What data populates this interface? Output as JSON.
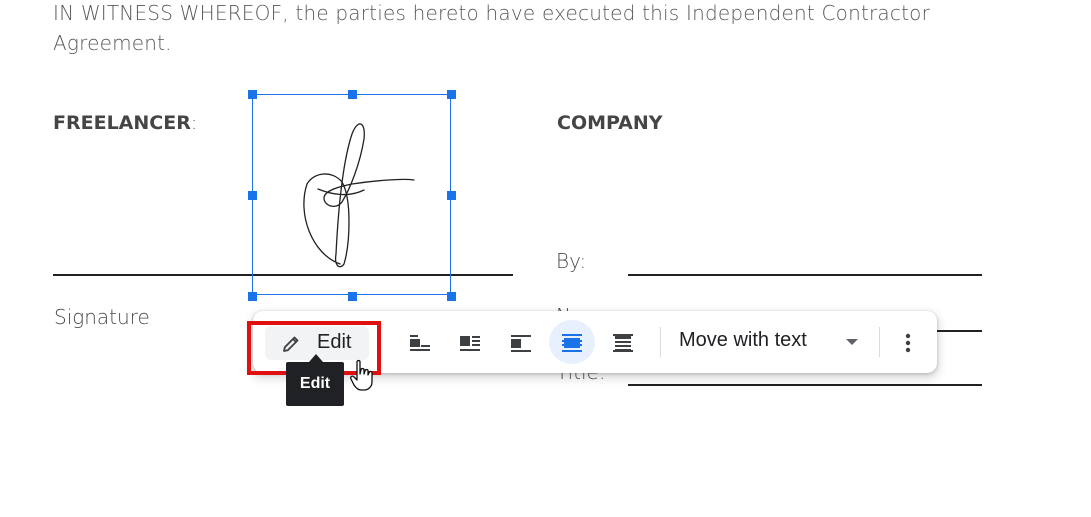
{
  "document": {
    "intro_text": "IN WITNESS WHEREOF, the parties hereto have executed this Independent Contractor Agreement.",
    "freelancer_label": "FREELANCER",
    "freelancer_colon": ":",
    "company_label": "COMPANY",
    "signature_caption": "Signature",
    "by_label": "By:",
    "name_label": "N",
    "title_label": "Title:"
  },
  "image_toolbar": {
    "edit_label": "Edit",
    "edit_tooltip": "Edit",
    "wrap_options": [
      "inline",
      "wrap-text",
      "break-text",
      "in-front-of-text",
      "behind-text"
    ],
    "active_wrap": "in-front-of-text",
    "position_select_value": "Move with text",
    "more_options_icon": "more-vert-icon"
  },
  "colors": {
    "selection_blue": "#1a73e8",
    "highlight_red": "#e01010",
    "tooltip_bg": "#202124",
    "active_bg": "#e8f0fe"
  }
}
